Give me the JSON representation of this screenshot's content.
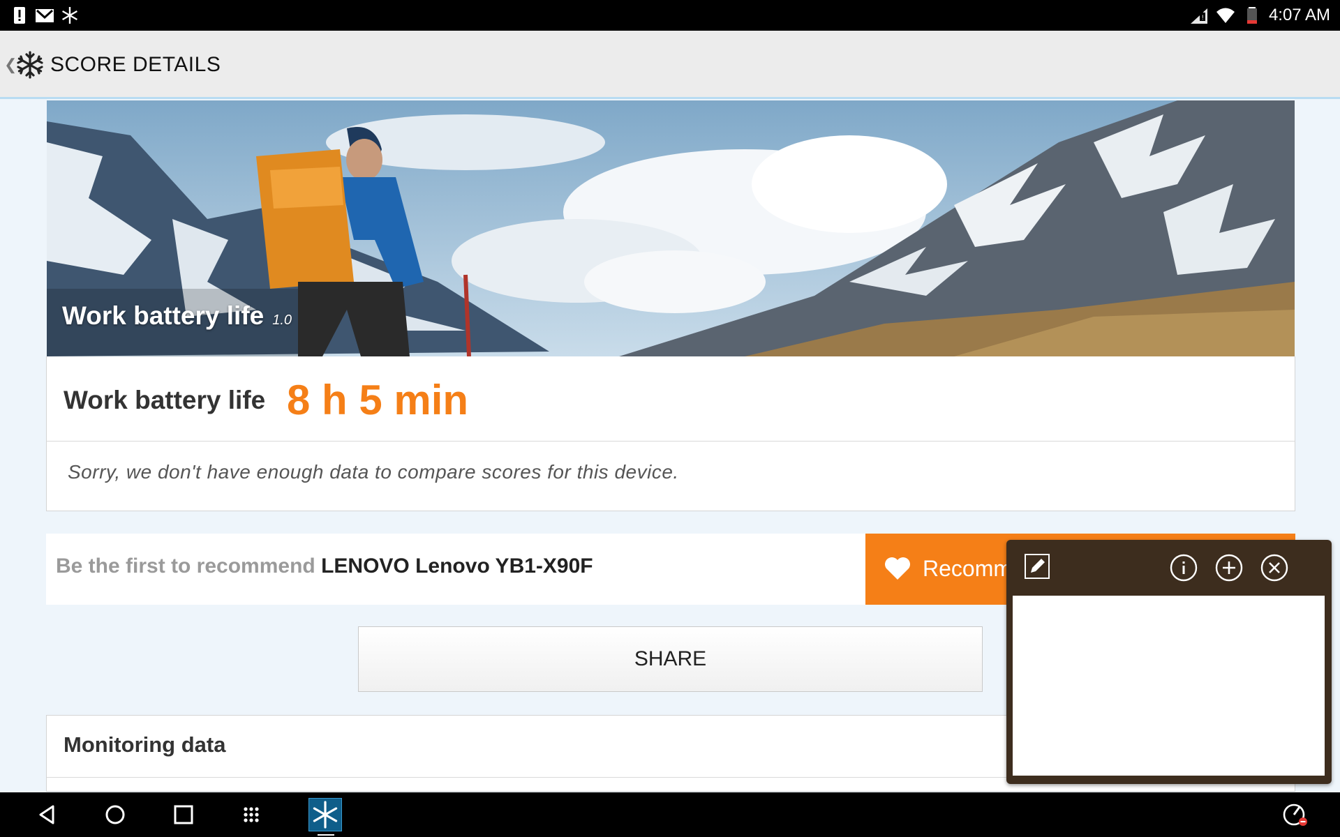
{
  "status_bar": {
    "time": "4:07 AM",
    "left_icons": [
      "alert-icon",
      "gmail-icon",
      "snowflake-icon"
    ],
    "right_icons": [
      "no-sim-icon",
      "wifi-icon",
      "battery-low-icon"
    ]
  },
  "action_bar": {
    "title": "SCORE DETAILS",
    "back_icon": "chevron-left-icon",
    "app_icon": "snowflake-icon"
  },
  "hero": {
    "label": "Work battery life",
    "version": "1.0"
  },
  "score": {
    "label": "Work battery life",
    "value": "8 h 5 min",
    "compare_note": "Sorry, we don't have enough data to compare scores for this device.",
    "accent_color": "#f57f17"
  },
  "recommend": {
    "lead": "Be the first to recommend",
    "device": "LENOVO Lenovo YB1-X90F",
    "button_label": "Recommend"
  },
  "share": {
    "label": "SHARE"
  },
  "monitoring": {
    "title": "Monitoring data"
  },
  "widget": {
    "icons": [
      "edit-icon",
      "info-icon",
      "add-icon",
      "close-icon"
    ]
  },
  "nav_bar": {
    "icons": [
      "back-icon",
      "home-icon",
      "recents-icon",
      "apps-grid-icon",
      "app-snowflake-icon",
      "speed-icon"
    ]
  }
}
